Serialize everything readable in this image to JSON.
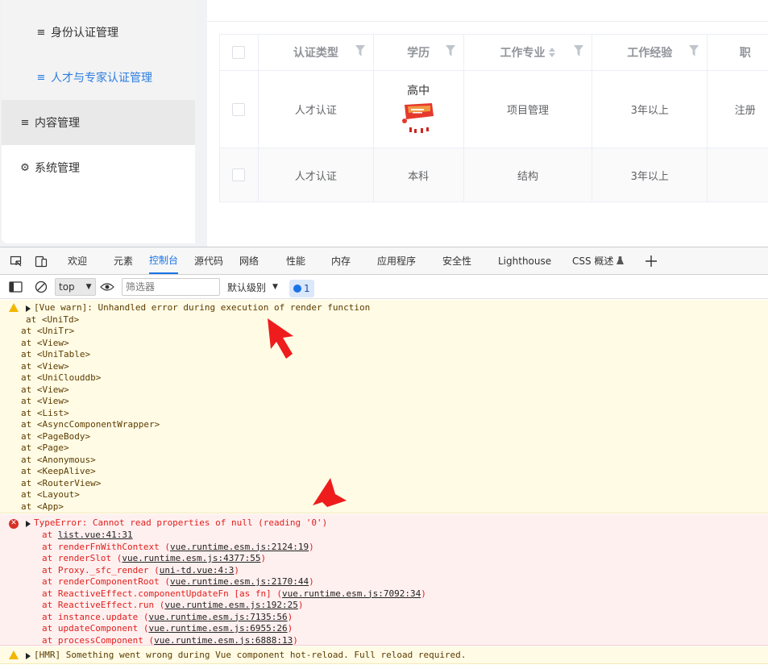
{
  "sidebar": {
    "items": [
      {
        "label": "身份认证管理",
        "icon": "list-icon"
      },
      {
        "label": "人才与专家认证管理",
        "icon": "list-icon"
      },
      {
        "label": "内容管理",
        "icon": "list-icon"
      },
      {
        "label": "系统管理",
        "icon": "gear-icon"
      }
    ]
  },
  "table": {
    "headers": [
      "认证类型",
      "学历",
      "工作专业",
      "工作经验",
      "职"
    ],
    "rows": [
      {
        "type": "人才认证",
        "education": "高中",
        "major": "项目管理",
        "experience": "3年以上",
        "title": "注册"
      },
      {
        "type": "人才认证",
        "education": "本科",
        "major": "结构",
        "experience": "3年以上",
        "title": ""
      }
    ]
  },
  "devtools": {
    "tabs": [
      "欢迎",
      "元素",
      "控制台",
      "源代码",
      "网络",
      "性能",
      "内存",
      "应用程序",
      "安全性",
      "Lighthouse",
      "CSS 概述"
    ],
    "active_tab": "控制台",
    "toolbar": {
      "context": "top",
      "filter_placeholder": "筛选器",
      "level": "默认级别",
      "issues_count": "1"
    },
    "console": {
      "warn1": {
        "title": "[Vue warn]: Unhandled error during execution of render function",
        "stack": [
          "at <UniTd>",
          "at <UniTr>",
          "at <View>",
          "at <UniTable>",
          "at <View>",
          "at <UniClouddb>",
          "at <View>",
          "at <View>",
          "at <List>",
          "at <AsyncComponentWrapper>",
          "at <PageBody>",
          "at <Page>",
          "at <Anonymous>",
          "at <KeepAlive>",
          "at <RouterView>",
          "at <Layout>",
          "at <App>"
        ]
      },
      "error": {
        "title": "TypeError: Cannot read properties of null (reading '0')",
        "stack": [
          {
            "fn": "at ",
            "link": "list.vue:41:31"
          },
          {
            "fn": "at renderFnWithContext (",
            "link": "vue.runtime.esm.js:2124:19",
            "end": ")"
          },
          {
            "fn": "at renderSlot (",
            "link": "vue.runtime.esm.js:4377:55",
            "end": ")"
          },
          {
            "fn": "at Proxy._sfc_render (",
            "link": "uni-td.vue:4:3",
            "end": ")"
          },
          {
            "fn": "at renderComponentRoot (",
            "link": "vue.runtime.esm.js:2170:44",
            "end": ")"
          },
          {
            "fn": "at ReactiveEffect.componentUpdateFn [as fn] (",
            "link": "vue.runtime.esm.js:7092:34",
            "end": ")"
          },
          {
            "fn": "at ReactiveEffect.run (",
            "link": "vue.runtime.esm.js:192:25",
            "end": ")"
          },
          {
            "fn": "at instance.update (",
            "link": "vue.runtime.esm.js:7135:56",
            "end": ")"
          },
          {
            "fn": "at updateComponent (",
            "link": "vue.runtime.esm.js:6955:26",
            "end": ")"
          },
          {
            "fn": "at processComponent (",
            "link": "vue.runtime.esm.js:6888:13",
            "end": ")"
          }
        ]
      },
      "warn2": {
        "title": "[HMR] Something went wrong during Vue component hot-reload. Full reload required."
      }
    }
  },
  "colors": {
    "accent": "#2b7de1",
    "devtools_active": "#1a73e8",
    "warn_bg": "#fffbe5",
    "error_bg": "#fff0f0",
    "error_text": "#e0201c",
    "arrow": "#ee1c1c"
  }
}
